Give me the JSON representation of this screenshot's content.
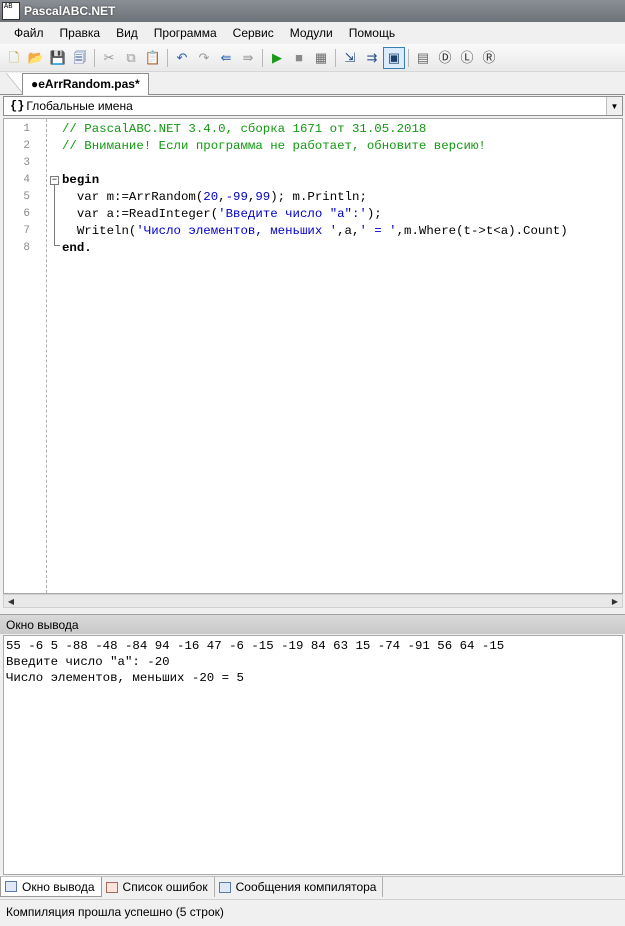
{
  "window": {
    "title": "PascalABC.NET",
    "app_icon_text": "AB"
  },
  "menu": [
    "Файл",
    "Правка",
    "Вид",
    "Программа",
    "Сервис",
    "Модули",
    "Помощь"
  ],
  "toolbar": {
    "icons": [
      "new-file-icon",
      "open-folder-icon",
      "save-icon",
      "save-all-icon",
      "cut-icon",
      "copy-icon",
      "paste-icon",
      "undo-icon",
      "redo-icon",
      "back-icon",
      "forward-icon",
      "run-icon",
      "stop-icon",
      "compile-icon",
      "step-into-icon",
      "step-over-icon",
      "output-window-icon",
      "form-icon",
      "d-icon",
      "l-icon",
      "r-icon"
    ]
  },
  "tab": {
    "label": "●eArrRandom.pas*"
  },
  "scope": {
    "icon": "{}",
    "text": "Глобальные имена"
  },
  "editor": {
    "line_numbers": [
      "1",
      "2",
      "3",
      "4",
      "5",
      "6",
      "7",
      "8"
    ],
    "lines": {
      "l1": "// PascalABC.NET 3.4.0, сборка 1671 от 31.05.2018",
      "l2": "// Внимание! Если программа не работает, обновите версию!",
      "l4_kw": "begin",
      "l5a": "  var m:=ArrRandom(",
      "l5b": "20",
      "l5c": ",",
      "l5d": "-99",
      "l5e": ",",
      "l5f": "99",
      "l5g": "); m.Println;",
      "l6a": "  var a:=ReadInteger(",
      "l6b": "'Введите число \"a\":'",
      "l6c": ");",
      "l7a": "  Writeln(",
      "l7b": "'Число элементов, меньших '",
      "l7c": ",a,",
      "l7d": "' = '",
      "l7e": ",m.Where(t->t<a).Count)",
      "l8_kw": "end."
    }
  },
  "output": {
    "header": "Окно вывода",
    "lines": [
      "55 -6 5 -88 -48 -84 94 -16 47 -6 -15 -19 84 63 15 -74 -91 56 64 -15",
      "Введите число \"a\": -20",
      "Число элементов, меньших -20 = 5"
    ]
  },
  "bottom_tabs": [
    "Окно вывода",
    "Список ошибок",
    "Сообщения компилятора"
  ],
  "status": "Компиляция прошла успешно (5 строк)",
  "colors": {
    "comment": "#119911",
    "string": "#0000cc",
    "title_bar": "#7a7f86"
  }
}
